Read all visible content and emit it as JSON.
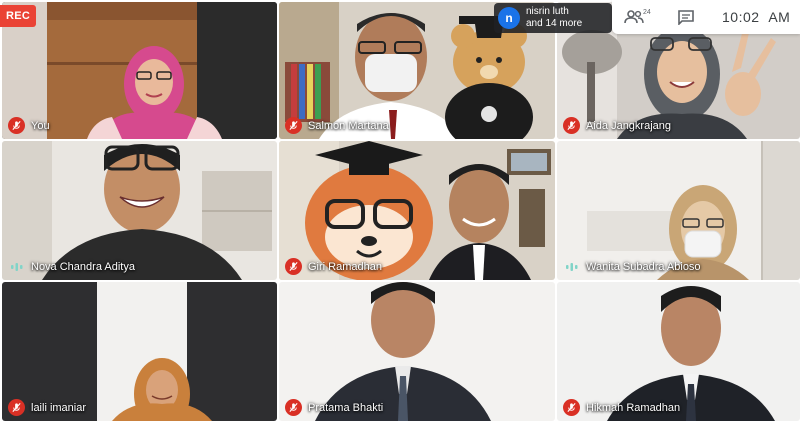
{
  "recording": {
    "label": "REC"
  },
  "notification": {
    "avatar_letter": "n",
    "line1": "nisrin luth",
    "line2": "and 14 more"
  },
  "topbar": {
    "participants_count": "24",
    "time": "10:02",
    "ampm": "AM"
  },
  "participants": [
    {
      "name": "You",
      "status": "muted"
    },
    {
      "name": "Salmon Martana",
      "status": "muted"
    },
    {
      "name": "Aida Jangkrajang",
      "status": "muted"
    },
    {
      "name": "Nova Chandra Aditya",
      "status": "speaking"
    },
    {
      "name": "Giri Ramadhan",
      "status": "muted"
    },
    {
      "name": "Wanita Subadra Abioso",
      "status": "speaking"
    },
    {
      "name": "laili imaniar",
      "status": "muted"
    },
    {
      "name": "Pratama Bhakti",
      "status": "muted"
    },
    {
      "name": "Hikmah Ramadhan",
      "status": "muted"
    }
  ],
  "colors": {
    "mute_red": "#d93025",
    "rec_red": "#ea4335",
    "speak_teal": "#81d4c8"
  }
}
